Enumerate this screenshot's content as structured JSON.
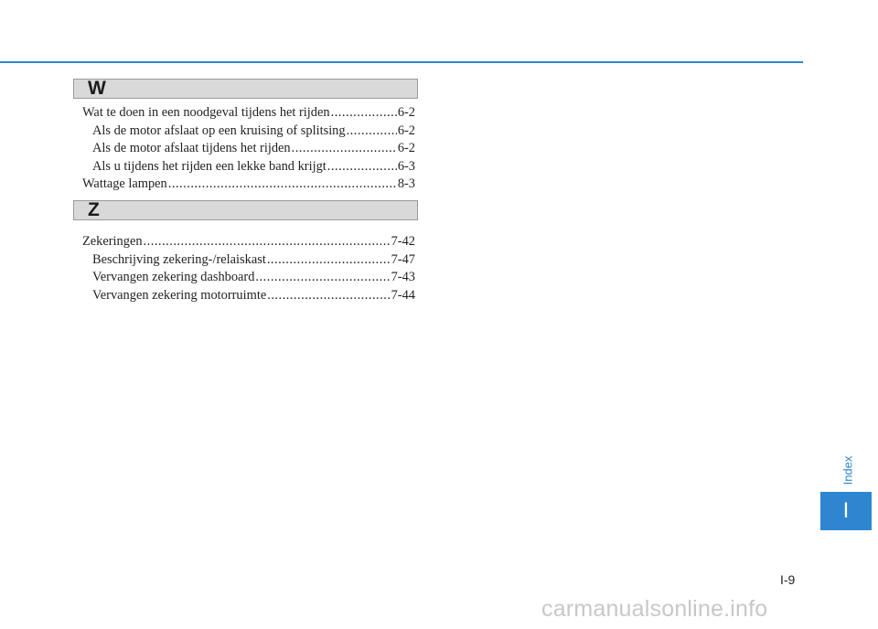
{
  "sections": [
    {
      "letter": "W",
      "entries": [
        {
          "label": "Wat te doen in een noodgeval tijdens het rijden ",
          "page": "6-2",
          "sub": false
        },
        {
          "label": "Als de motor afslaat op een kruising of splitsing ",
          "page": "6-2",
          "sub": true
        },
        {
          "label": "Als de motor afslaat tijdens het rijden",
          "page": "6-2",
          "sub": true
        },
        {
          "label": "Als u tijdens het rijden een lekke band krijgt",
          "page": "6-3",
          "sub": true
        },
        {
          "label": "Wattage lampen ",
          "page": "8-3",
          "sub": false
        }
      ]
    },
    {
      "letter": "Z",
      "entries": [
        {
          "label": "Zekeringen ",
          "page": "7-42",
          "sub": false
        },
        {
          "label": "Beschrijving zekering-/relaiskast",
          "page": "7-47",
          "sub": true
        },
        {
          "label": "Vervangen zekering dashboard ",
          "page": "7-43",
          "sub": true
        },
        {
          "label": "Vervangen zekering motorruimte ",
          "page": "7-44",
          "sub": true
        }
      ]
    }
  ],
  "side_tab": {
    "label": "Index",
    "letter": "I"
  },
  "page_number": "I-9",
  "watermark": "carmanualsonline.info",
  "colors": {
    "accent": "#2e86d1",
    "section_bar": "#d9d9d9"
  }
}
